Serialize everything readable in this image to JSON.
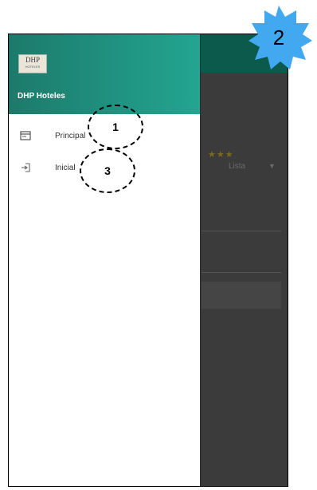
{
  "drawer": {
    "logo": {
      "main": "DHP",
      "sub": "HOTELES"
    },
    "brand_title": "DHP Hoteles",
    "items": [
      {
        "label": "Principal",
        "icon": "calendar-card-icon"
      },
      {
        "label": "Inicial",
        "icon": "login-icon"
      }
    ]
  },
  "background_app": {
    "rating_stars": "★★★",
    "select_value": "Lista"
  },
  "annotations": {
    "callout_1": "1",
    "callout_3": "3",
    "badge": "2"
  },
  "colors": {
    "drawer_header_start": "#1c7a6a",
    "drawer_header_end": "#23a592",
    "app_bar": "#0b5a4b",
    "badge": "#42a9f0"
  }
}
